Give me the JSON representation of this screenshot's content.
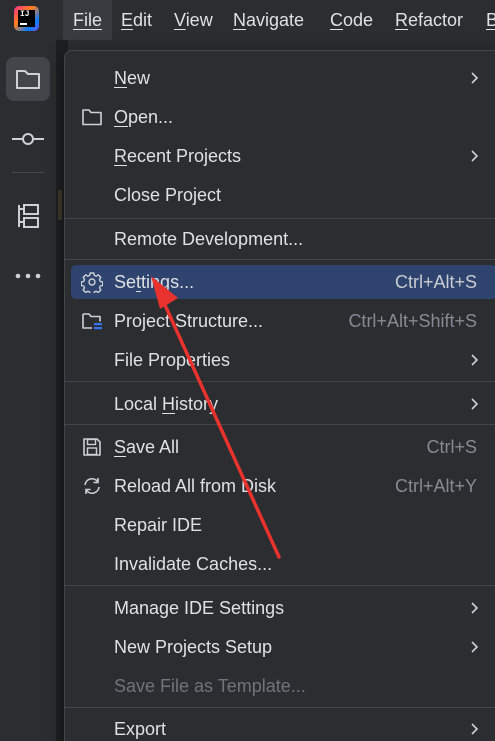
{
  "menubar": {
    "items": [
      {
        "label": "File",
        "mnemonic_index": 0
      },
      {
        "label": "Edit",
        "mnemonic_index": 0
      },
      {
        "label": "View",
        "mnemonic_index": 0
      },
      {
        "label": "Navigate",
        "mnemonic_index": 0
      },
      {
        "label": "Code",
        "mnemonic_index": 0
      },
      {
        "label": "Refactor",
        "mnemonic_index": 0
      },
      {
        "label": "B",
        "mnemonic_index": 0
      }
    ]
  },
  "toolstrip": {
    "icons": [
      "project-folder-icon",
      "commit-icon",
      "structure-icon",
      "more-icon"
    ]
  },
  "file_menu": {
    "items": [
      {
        "id": "new",
        "pre": "",
        "mn": "N",
        "post": "ew",
        "shortcut": "",
        "submenu": true
      },
      {
        "id": "open",
        "pre": "",
        "mn": "O",
        "post": "pen...",
        "shortcut": "",
        "submenu": false
      },
      {
        "id": "recent",
        "pre": "",
        "mn": "R",
        "post": "ecent Projects",
        "shortcut": "",
        "submenu": true
      },
      {
        "id": "close",
        "pre": "Close Project",
        "mn": "",
        "post": "",
        "shortcut": "",
        "submenu": false
      },
      {
        "id": "remote",
        "pre": "Remote Development...",
        "mn": "",
        "post": "",
        "shortcut": "",
        "submenu": false
      },
      {
        "id": "settings",
        "pre": "Se",
        "mn": "t",
        "post": "tings...",
        "shortcut": "Ctrl+Alt+S",
        "submenu": false
      },
      {
        "id": "structure",
        "pre": "Project Structure...",
        "mn": "",
        "post": "",
        "shortcut": "Ctrl+Alt+Shift+S",
        "submenu": false
      },
      {
        "id": "properties",
        "pre": "File Properties",
        "mn": "",
        "post": "",
        "shortcut": "",
        "submenu": true
      },
      {
        "id": "history",
        "pre": "Local ",
        "mn": "H",
        "post": "istory",
        "shortcut": "",
        "submenu": true
      },
      {
        "id": "saveall",
        "pre": "",
        "mn": "S",
        "post": "ave All",
        "shortcut": "Ctrl+S",
        "submenu": false
      },
      {
        "id": "reload",
        "pre": "Reload All from Disk",
        "mn": "",
        "post": "",
        "shortcut": "Ctrl+Alt+Y",
        "submenu": false
      },
      {
        "id": "repair",
        "pre": "Repair IDE",
        "mn": "",
        "post": "",
        "shortcut": "",
        "submenu": false
      },
      {
        "id": "invalidate",
        "pre": "Invalidate Caches...",
        "mn": "",
        "post": "",
        "shortcut": "",
        "submenu": false
      },
      {
        "id": "manage",
        "pre": "Manage IDE Settings",
        "mn": "",
        "post": "",
        "shortcut": "",
        "submenu": true
      },
      {
        "id": "newsetup",
        "pre": "New Projects Setup",
        "mn": "",
        "post": "",
        "shortcut": "",
        "submenu": true
      },
      {
        "id": "template",
        "pre": "Save File as Template...",
        "mn": "",
        "post": "",
        "shortcut": "",
        "submenu": false,
        "disabled": true
      },
      {
        "id": "export",
        "pre": "Export",
        "mn": "",
        "post": "",
        "shortcut": "",
        "submenu": true
      }
    ]
  },
  "colors": {
    "background": "#2b2d30",
    "selection": "#2e436e",
    "text": "#dfe1e5",
    "shortcut_text": "#868a91",
    "disabled_text": "#6f737a",
    "annotation_arrow": "#e8322d"
  }
}
